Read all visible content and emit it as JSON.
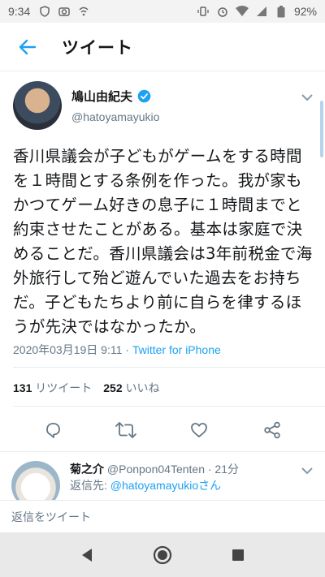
{
  "status_bar": {
    "time": "9:34",
    "battery": "92%"
  },
  "header": {
    "title": "ツイート"
  },
  "tweet": {
    "author_name": "鳩山由紀夫",
    "author_handle": "@hatoyamayukio",
    "text": "香川県議会が子どもがゲームをする時間を１時間とする条例を作った。我が家もかつてゲーム好きの息子に１時間までと約束させたことがある。基本は家庭で決めることだ。香川県議会は3年前税金で海外旅行して殆ど遊んでいた過去をお持ちだ。子どもたちより前に自らを律するほうが先決ではなかったか。",
    "date": "2020年03月19日 9:11",
    "separator": " · ",
    "source": "Twitter for iPhone",
    "retweets_count": "131",
    "retweets_label": "リツイート",
    "likes_count": "252",
    "likes_label": "いいね"
  },
  "reply": {
    "name": "菊之介",
    "handle": "@Ponpon04Tenten",
    "time": " · 21分",
    "reply_to_prefix": "返信先: ",
    "reply_to_mention": "@hatoyamayukioさん"
  },
  "compose": {
    "placeholder": "返信をツイート"
  },
  "colors": {
    "accent": "#1da1f2",
    "text": "#14171a",
    "muted": "#657786"
  },
  "icons": [
    "back-arrow-icon",
    "verified-icon",
    "chevron-down-icon",
    "reply-icon",
    "retweet-icon",
    "like-icon",
    "share-icon",
    "nav-back-icon",
    "nav-home-icon",
    "nav-recents-icon"
  ]
}
